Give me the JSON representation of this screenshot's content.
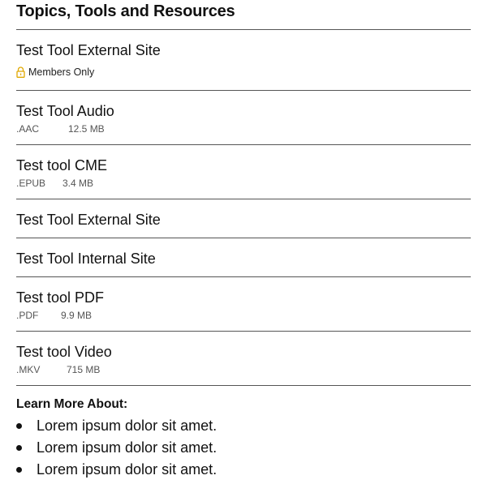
{
  "panel": {
    "title": "Topics, Tools and Resources"
  },
  "resources": [
    {
      "title": "Test Tool External Site",
      "members_label": "Members Only",
      "lock_icon": "lock-icon",
      "accent": "#e0a800"
    },
    {
      "title": "Test Tool Audio",
      "type": ".AAC",
      "size": "12.5 MB"
    },
    {
      "title": "Test tool CME",
      "type": ".EPUB",
      "size": "3.4 MB"
    },
    {
      "title": "Test Tool External Site"
    },
    {
      "title": "Test Tool Internal Site"
    },
    {
      "title": "Test tool PDF",
      "type": ".PDF",
      "size": "9.9 MB"
    },
    {
      "title": "Test tool Video",
      "type": ".MKV",
      "size": "715 MB"
    }
  ],
  "learn_more": {
    "heading": "Learn More About:",
    "items": [
      "Lorem ipsum dolor sit amet.",
      "Lorem ipsum dolor sit amet.",
      "Lorem ipsum dolor sit amet."
    ]
  }
}
